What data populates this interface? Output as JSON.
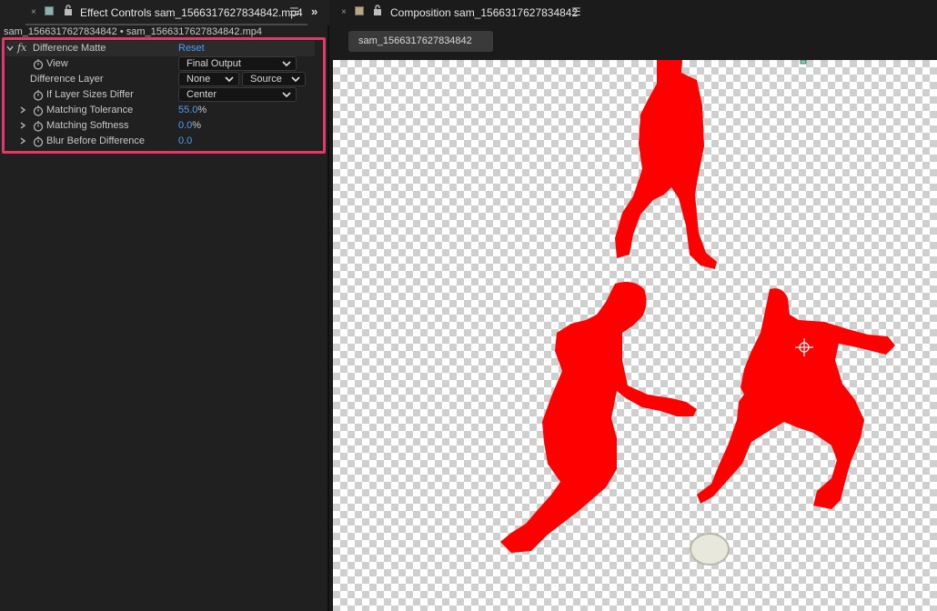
{
  "effect_controls": {
    "tab_close": "×",
    "tab_title": "Effect Controls sam_1566317627834842.mp4",
    "tab_menu": "☰",
    "overflow": "»",
    "layer_path": "sam_1566317627834842 • sam_1566317627834842.mp4",
    "effect": {
      "fx": "fx",
      "name": "Difference Matte",
      "reset": "Reset"
    },
    "properties": {
      "view": {
        "label": "View",
        "value": "Final Output"
      },
      "difference_layer": {
        "label": "Difference Layer",
        "value": "None",
        "source": "Source"
      },
      "if_layer_sizes_differ": {
        "label": "If Layer Sizes Differ",
        "value": "Center"
      },
      "matching_tolerance": {
        "label": "Matching Tolerance",
        "value": "55.0",
        "unit": "%"
      },
      "matching_softness": {
        "label": "Matching Softness",
        "value": "0.0",
        "unit": "%"
      },
      "blur_before_difference": {
        "label": "Blur Before Difference",
        "value": "0.0"
      }
    }
  },
  "composition": {
    "tab_close": "×",
    "tab_title": "Composition sam_1566317627834842",
    "tab_menu": "☰",
    "subtab_label": "sam_1566317627834842"
  },
  "colors": {
    "highlight": "#e2386a",
    "matte_red": "#ff0000",
    "value_blue": "#4e9df0"
  }
}
